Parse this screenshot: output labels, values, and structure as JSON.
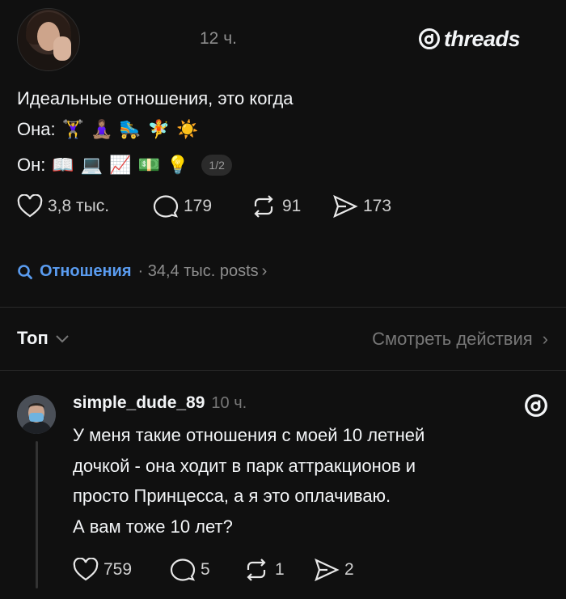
{
  "header": {
    "time": "12 ч.",
    "brand": "threads"
  },
  "post": {
    "line1": "Идеальные отношения, это когда",
    "line2_prefix": "Она:",
    "line2_emojis": [
      "🏋️‍♀️",
      "🧘🏽‍♀️",
      "🛼",
      "🧚",
      "☀️"
    ],
    "line3_prefix": "Он:",
    "line3_emojis": [
      "📖",
      "💻",
      "📈",
      "💵",
      "💡"
    ],
    "image_counter": "1/2",
    "likes": "3,8 тыс.",
    "replies": "179",
    "reposts": "91",
    "shares": "173"
  },
  "topic": {
    "name": "Отношения",
    "meta": "· 34,4 тыс. posts",
    "chevron": "›"
  },
  "sort": {
    "label": "Топ",
    "activity_label": "Смотреть действия",
    "chevron": "›"
  },
  "reply": {
    "username": "simple_dude_89",
    "time": "10 ч.",
    "lines": [
      "У меня такие отношения с моей 10 летней",
      "дочкой - она ходит в парк аттракционов и",
      "просто Принцесса, а я это оплачиваю.",
      "А вам тоже 10 лет?"
    ],
    "likes": "759",
    "replies": "5",
    "reposts": "1",
    "shares": "2"
  },
  "icons": {
    "brand": "threads-logo-icon",
    "like": "heart-icon",
    "reply": "comment-icon",
    "repost": "repost-icon",
    "share": "send-icon",
    "search": "search-icon"
  },
  "colors": {
    "background": "#101010",
    "accent": "#5a9cf0",
    "muted": "#8e8e8e"
  }
}
